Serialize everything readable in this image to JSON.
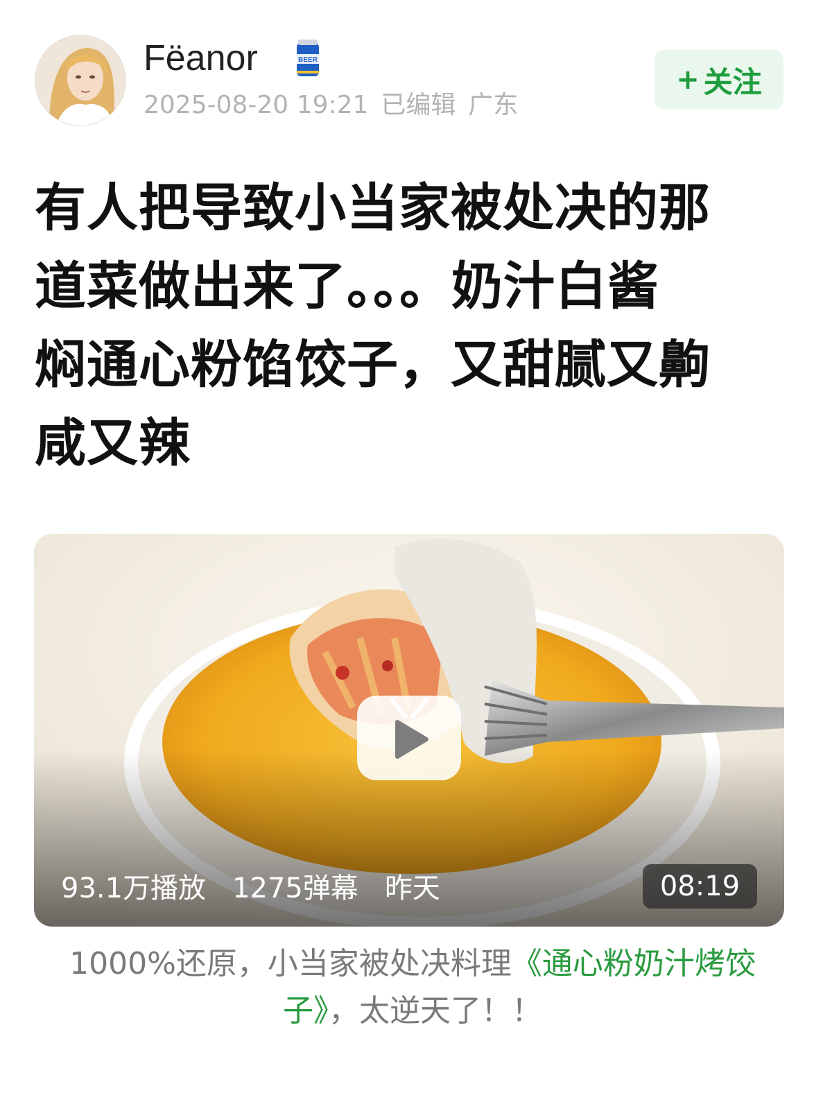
{
  "author": {
    "name": "Fëanor",
    "date": "2025-08-20 19:21",
    "edited": "已编辑",
    "location": "广东",
    "avatar_icon": "avatar-portrait",
    "badge_icon": "beer-can-icon",
    "badge_text": "BEER"
  },
  "follow": {
    "plus": "+",
    "label": "关注",
    "color": "#1f9e3e"
  },
  "post": {
    "title_lines": [
      "有人把导致小当家被处决的那",
      "道菜做出来了。。。奶汁白酱",
      "焖通心粉馅饺子，又甜腻又齁",
      "咸又辣"
    ]
  },
  "video": {
    "plays": "93.1万播放",
    "danmaku": "1275弹幕",
    "time": "昨天",
    "duration": "08:19",
    "play_icon": "play-icon"
  },
  "caption": {
    "prefix": "1000%还原，小当家被处决料理",
    "highlight_line1": "《通心粉奶汁烤饺",
    "highlight_line2": "子》",
    "suffix": "，太逆天了！！",
    "highlight_color": "#2a9b3f"
  }
}
